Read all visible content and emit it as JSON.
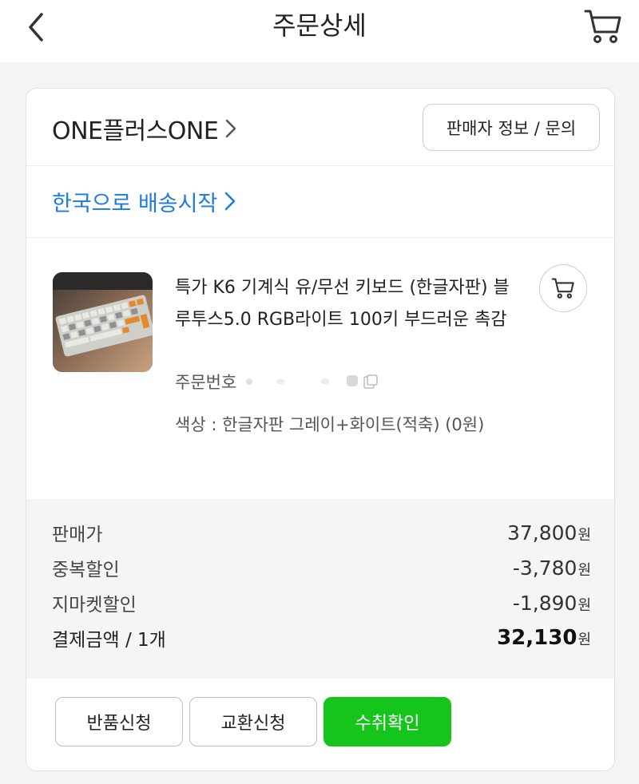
{
  "header": {
    "title": "주문상세",
    "back_icon": "chevron-left-icon",
    "cart_icon": "cart-icon"
  },
  "seller": {
    "name": "ONE플러스ONE",
    "info_button": "판매자 정보 / 문의"
  },
  "shipping": {
    "status_link": "한국으로 배송시작"
  },
  "product": {
    "title": "특가 K6 기계식 유/무선 키보드 (한글자판) 블루투스5.0 RGB라이트 100키 부드러운 촉감",
    "order_number_label": "주문번호",
    "option": "색상 : 한글자판 그레이+화이트(적축) (0원)",
    "thumbnail_icon": "keyboard-product-image"
  },
  "prices": {
    "currency_unit": "원",
    "rows": [
      {
        "label": "판매가",
        "value": "37,800"
      },
      {
        "label": "중복할인",
        "value": "-3,780"
      },
      {
        "label": "지마켓할인",
        "value": "-1,890"
      }
    ],
    "total": {
      "label": "결제금액 / 1개",
      "value": "32,130"
    }
  },
  "actions": {
    "return_label": "반품신청",
    "exchange_label": "교환신청",
    "confirm_label": "수취확인"
  },
  "colors": {
    "accent_green": "#16c51c",
    "link_blue": "#1b7be0"
  }
}
